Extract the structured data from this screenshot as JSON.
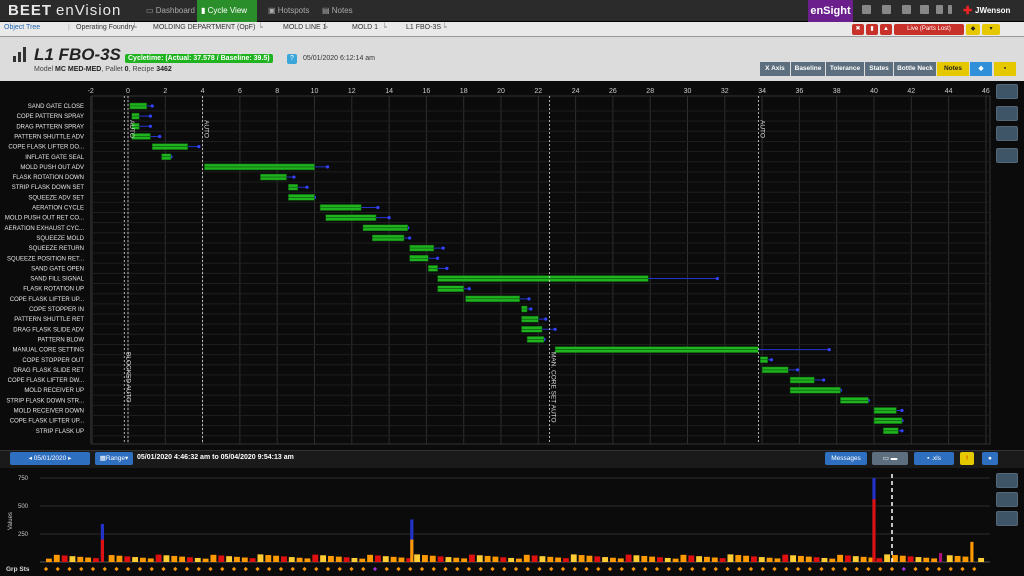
{
  "app": {
    "logo": "BEET",
    "name": "enVision"
  },
  "nav": {
    "tabs": [
      {
        "label": "Dashboard",
        "active": false
      },
      {
        "label": "Cycle View",
        "active": true
      },
      {
        "label": "Hotspots",
        "active": false
      },
      {
        "label": "Notes",
        "active": false
      }
    ],
    "ensight": "enSight",
    "user": "JWenson"
  },
  "breadcrumb": {
    "object_tree": "Object Tree",
    "items": [
      "Operating Foundry",
      "MOLDING DEPARTMENT (OpF)",
      "MOLD LINE 1",
      "MOLD 1",
      "L1 FBO-3S"
    ],
    "live_label": "Live (Parts Lost)"
  },
  "header": {
    "title": "L1 FBO-3S",
    "cycletime": "Cycletime: (Actual: 37.578 / Baseline: 39.5)",
    "help": "?",
    "datetime": "05/01/2020 6:12:14 am",
    "model_label": "Model",
    "model": "MC MED-MED",
    "pallet_label": "Pallet",
    "pallet": "0",
    "recipe_label": "Recipe",
    "recipe": "3462",
    "buttons": [
      "X Axis",
      "Baseline",
      "Tolerance",
      "States",
      "Bottle Neck",
      "Notes"
    ]
  },
  "colors": {
    "green": "#1fb31f",
    "blue": "#2233cc",
    "red": "#e01010",
    "orange": "#ff9900",
    "yellow": "#e6c800"
  },
  "gantt": {
    "x_ticks": [
      -2,
      0,
      2,
      4,
      6,
      8,
      10,
      12,
      14,
      16,
      18,
      20,
      22,
      24,
      26,
      28,
      30,
      32,
      34,
      36,
      38,
      40,
      42,
      44,
      46
    ],
    "markers": [
      {
        "x": -0.2,
        "label": "BLOCKED AUTO"
      },
      {
        "x": 0.0,
        "label": "AUTO"
      },
      {
        "x": 4.0,
        "label": "AUTO"
      },
      {
        "x": 22.6,
        "label": "MAN. CORE SET AUTO"
      },
      {
        "x": 33.8,
        "label": "AUTO"
      }
    ],
    "steps": [
      {
        "name": "SAND GATE CLOSE",
        "start": 0.1,
        "end": 1.0,
        "tol": 1.3
      },
      {
        "name": "COPE PATTERN SPRAY",
        "start": 0.2,
        "end": 0.6,
        "tol": 1.2
      },
      {
        "name": "DRAG PATTERN SPRAY",
        "start": 0.2,
        "end": 0.6,
        "tol": 1.2
      },
      {
        "name": "PATTERN SHUTTLE ADV",
        "start": 0.2,
        "end": 1.2,
        "tol": 1.7
      },
      {
        "name": "COPE FLASK LIFTER DO...",
        "start": 1.3,
        "end": 3.2,
        "tol": 3.8
      },
      {
        "name": "INFLATE GATE SEAL",
        "start": 1.8,
        "end": 2.3,
        "tol": 2.3
      },
      {
        "name": "MOLD PUSH OUT ADV",
        "start": 4.1,
        "end": 10.0,
        "tol": 10.7
      },
      {
        "name": "FLASK ROTATION DOWN",
        "start": 7.1,
        "end": 8.5,
        "tol": 8.9
      },
      {
        "name": "STRIP FLASK DOWN SET",
        "start": 8.6,
        "end": 9.1,
        "tol": 9.6
      },
      {
        "name": "SQUEEZE ADV SET",
        "start": 8.6,
        "end": 10.0,
        "tol": 10.0
      },
      {
        "name": "AERATION CYCLE",
        "start": 10.3,
        "end": 12.5,
        "tol": 13.4
      },
      {
        "name": "MOLD PUSH OUT RET CO...",
        "start": 10.6,
        "end": 13.3,
        "tol": 14.0
      },
      {
        "name": "AERATION EXHAUST CYC...",
        "start": 12.6,
        "end": 15.0,
        "tol": 15.0
      },
      {
        "name": "SQUEEZE MOLD",
        "start": 13.1,
        "end": 14.8,
        "tol": 15.1
      },
      {
        "name": "SQUEEZE RETURN",
        "start": 15.1,
        "end": 16.4,
        "tol": 16.9
      },
      {
        "name": "SQUEEZE POSITION RET...",
        "start": 15.1,
        "end": 16.1,
        "tol": 16.6
      },
      {
        "name": "SAND GATE OPEN",
        "start": 16.1,
        "end": 16.6,
        "tol": 17.1
      },
      {
        "name": "SAND FILL SIGNAL",
        "start": 16.6,
        "end": 27.9,
        "tol": 31.6
      },
      {
        "name": "FLASK ROTATION UP",
        "start": 16.6,
        "end": 18.0,
        "tol": 18.3
      },
      {
        "name": "COPE FLASK LIFTER UP...",
        "start": 18.1,
        "end": 21.0,
        "tol": 21.5
      },
      {
        "name": "COPE STOPPER IN",
        "start": 21.1,
        "end": 21.4,
        "tol": 21.6
      },
      {
        "name": "PATTERN SHUTTLE RET",
        "start": 21.1,
        "end": 22.0,
        "tol": 22.4
      },
      {
        "name": "DRAG FLASK SLIDE ADV",
        "start": 21.1,
        "end": 22.2,
        "tol": 22.9
      },
      {
        "name": "PATTERN BLOW",
        "start": 21.4,
        "end": 22.3,
        "tol": 22.3
      },
      {
        "name": "MANUAL CORE SETTING",
        "start": 22.9,
        "end": 33.8,
        "tol": 37.6
      },
      {
        "name": "COPE STOPPER OUT",
        "start": 33.9,
        "end": 34.3,
        "tol": 34.5
      },
      {
        "name": "DRAG FLASK SLIDE RET",
        "start": 34.0,
        "end": 35.4,
        "tol": 35.9
      },
      {
        "name": "COPE FLASK LIFTER DW...",
        "start": 35.5,
        "end": 36.8,
        "tol": 37.3
      },
      {
        "name": "MOLD RECEIVER UP",
        "start": 35.5,
        "end": 38.2,
        "tol": 38.2
      },
      {
        "name": "STRIP FLASK DOWN STR...",
        "start": 38.2,
        "end": 39.7,
        "tol": 39.7
      },
      {
        "name": "MOLD RECEIVER DOWN",
        "start": 40.0,
        "end": 41.2,
        "tol": 41.5
      },
      {
        "name": "COPE FLASK LIFTER UP...",
        "start": 40.0,
        "end": 41.5,
        "tol": 41.5
      },
      {
        "name": "STRIP FLASK UP",
        "start": 40.5,
        "end": 41.3,
        "tol": 41.5
      }
    ]
  },
  "range": {
    "date": "05/01/2020",
    "range_label": "Range",
    "text": "05/01/2020 4:46:32 am to 05/04/2020 9:54:13 am",
    "messages": "Messages",
    "xls": ".xls"
  },
  "chart_data": {
    "type": "bar",
    "ylabel": "Values",
    "footer_label": "Grp Sts",
    "yticks": [
      250,
      500,
      750
    ],
    "ylim": [
      0,
      750
    ],
    "bars": [
      {
        "i": 14,
        "red": 200,
        "blue": 340
      },
      {
        "i": 93,
        "orange": 200,
        "blue": 380
      },
      {
        "i": 211,
        "red": 560,
        "blue": 750
      },
      {
        "i": 236,
        "orange": 180
      },
      {
        "i": 228,
        "purple": 80
      }
    ]
  }
}
